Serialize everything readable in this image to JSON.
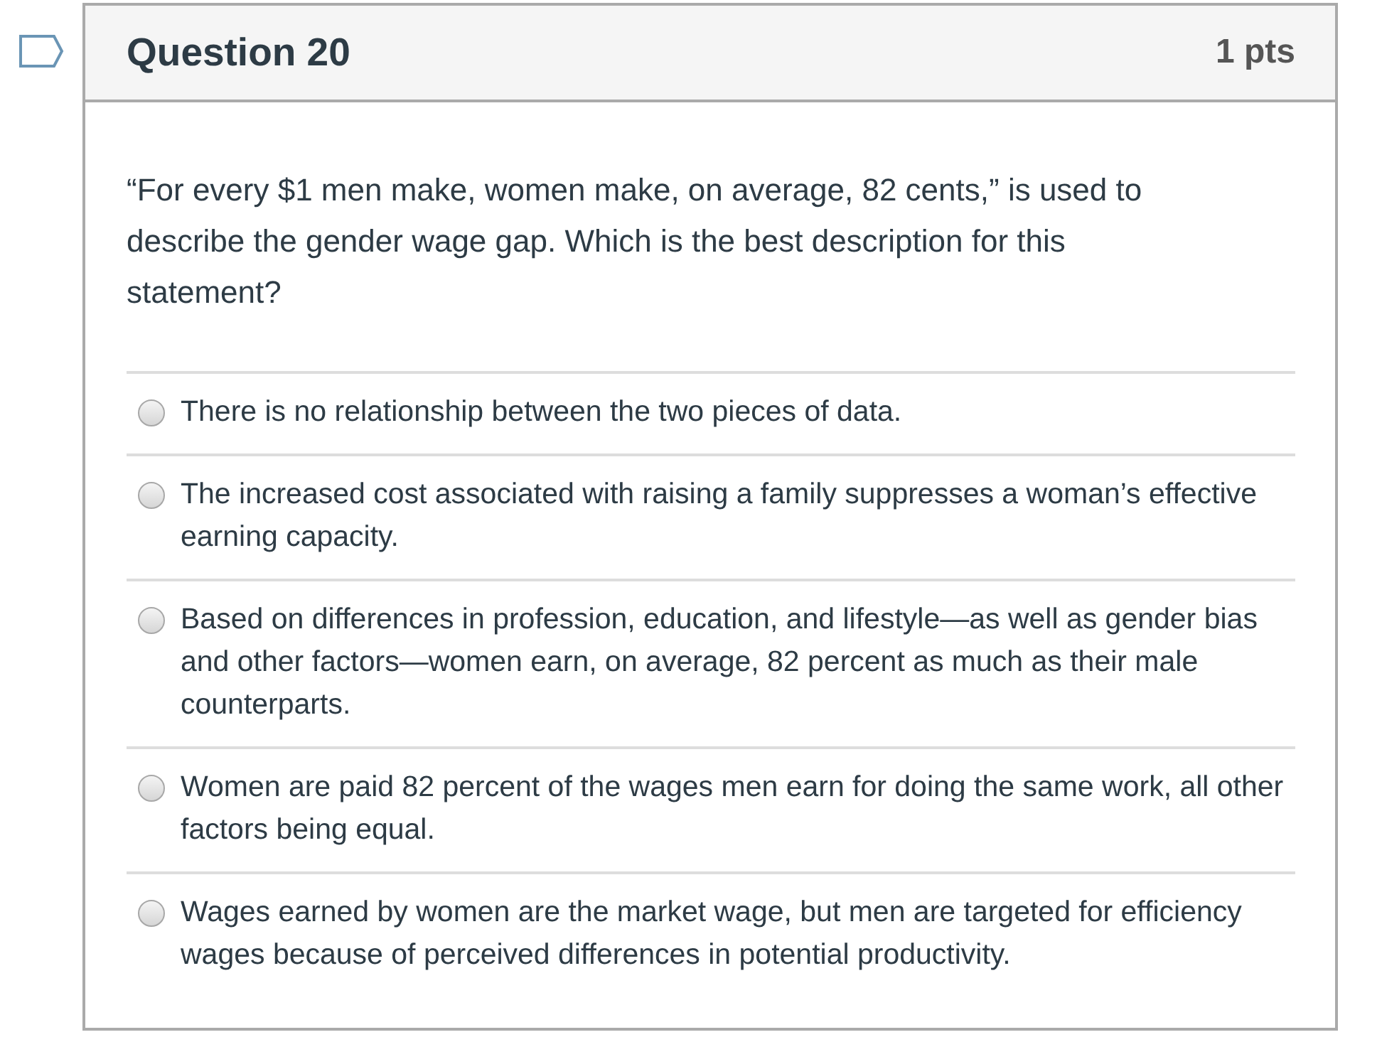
{
  "question": {
    "flagged": false,
    "title": "Question 20",
    "points": "1 pts",
    "text": "“For every $1 men make, women make, on average, 82 cents,” is used to describe the gender wage gap. Which is the best description for this statement?"
  },
  "answers": [
    {
      "text": "There is no relationship between the two pieces of data.",
      "selected": false
    },
    {
      "text": "The increased cost associated with raising a family suppresses a woman’s effective earning capacity.",
      "selected": false
    },
    {
      "text": "Based on differences in profession, education, and lifestyle—as well as gender bias and other factors—women earn, on average, 82 percent as much as their male counterparts.",
      "selected": false
    },
    {
      "text": "Women are paid 82 percent of the wages men earn for doing the same work, all other factors being equal.",
      "selected": false
    },
    {
      "text": "Wages earned by women are the market wage, but men are targeted for efficiency wages because of perceived differences in potential productivity.",
      "selected": false
    }
  ]
}
